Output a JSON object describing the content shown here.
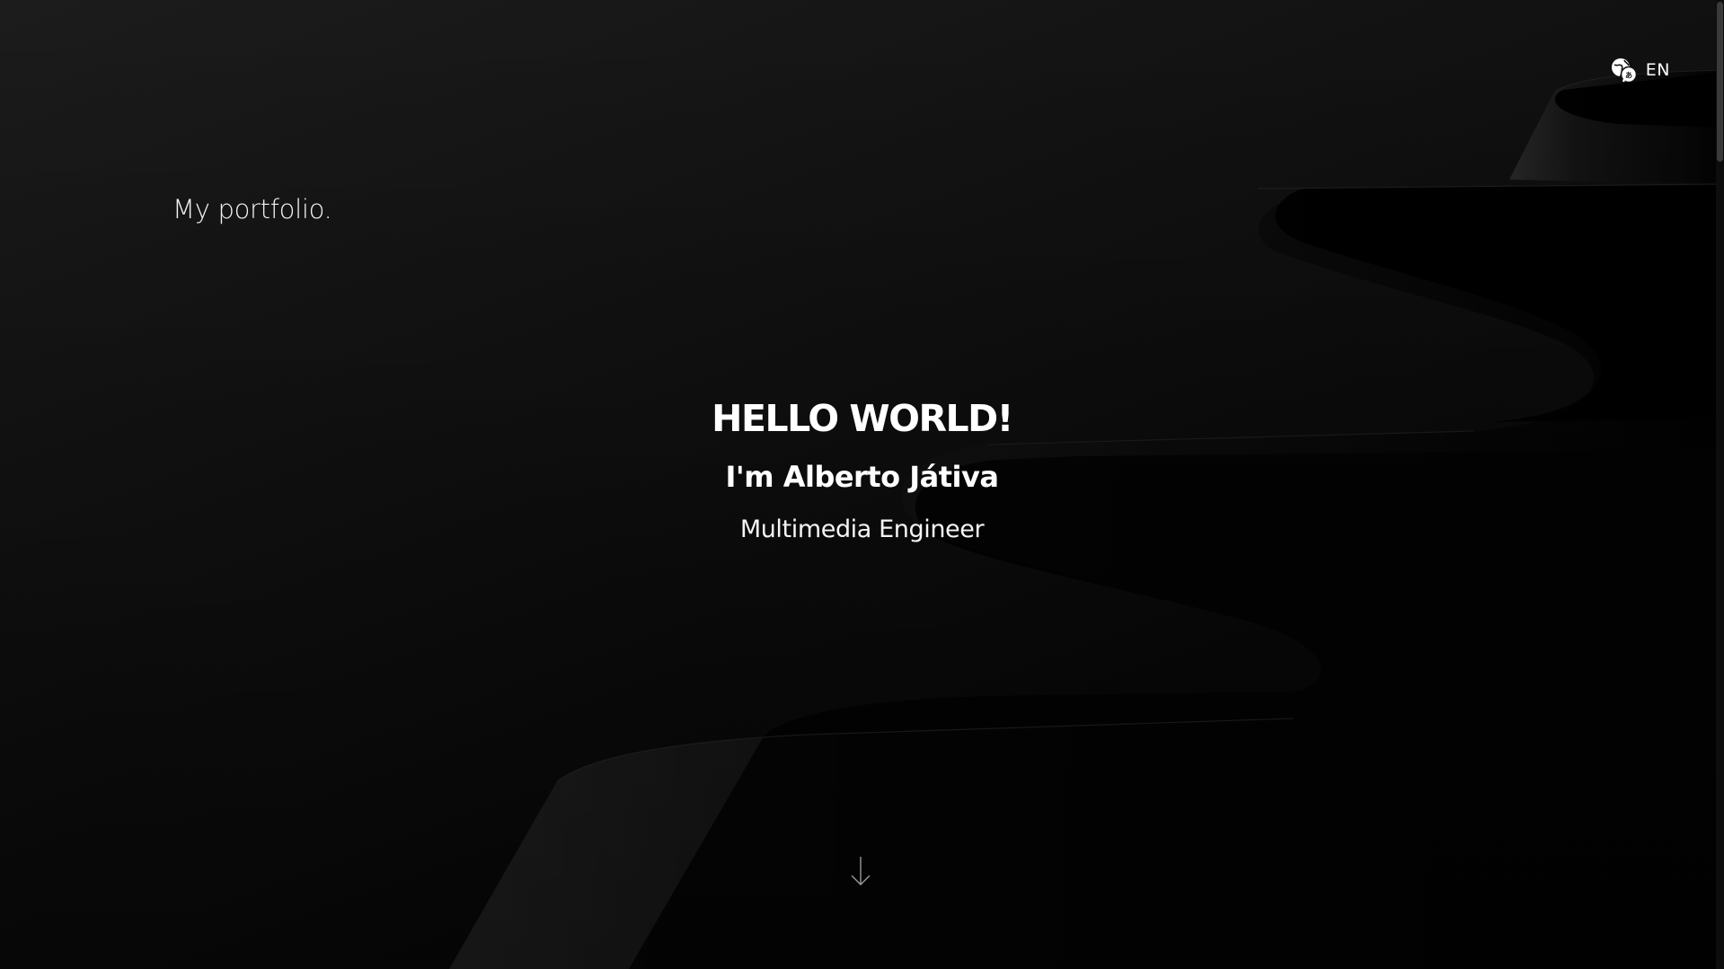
{
  "header": {
    "language": {
      "icon": "translate-icon",
      "label": "EN"
    }
  },
  "brand": {
    "text": "My portfolio."
  },
  "hero": {
    "title": "HELLO WORLD!",
    "name": "I'm Alberto Játiva",
    "role": "Multimedia Engineer"
  },
  "scroll_hint": {
    "icon": "arrow-down-icon"
  },
  "colors": {
    "background": "#121212",
    "text": "#ffffff"
  }
}
